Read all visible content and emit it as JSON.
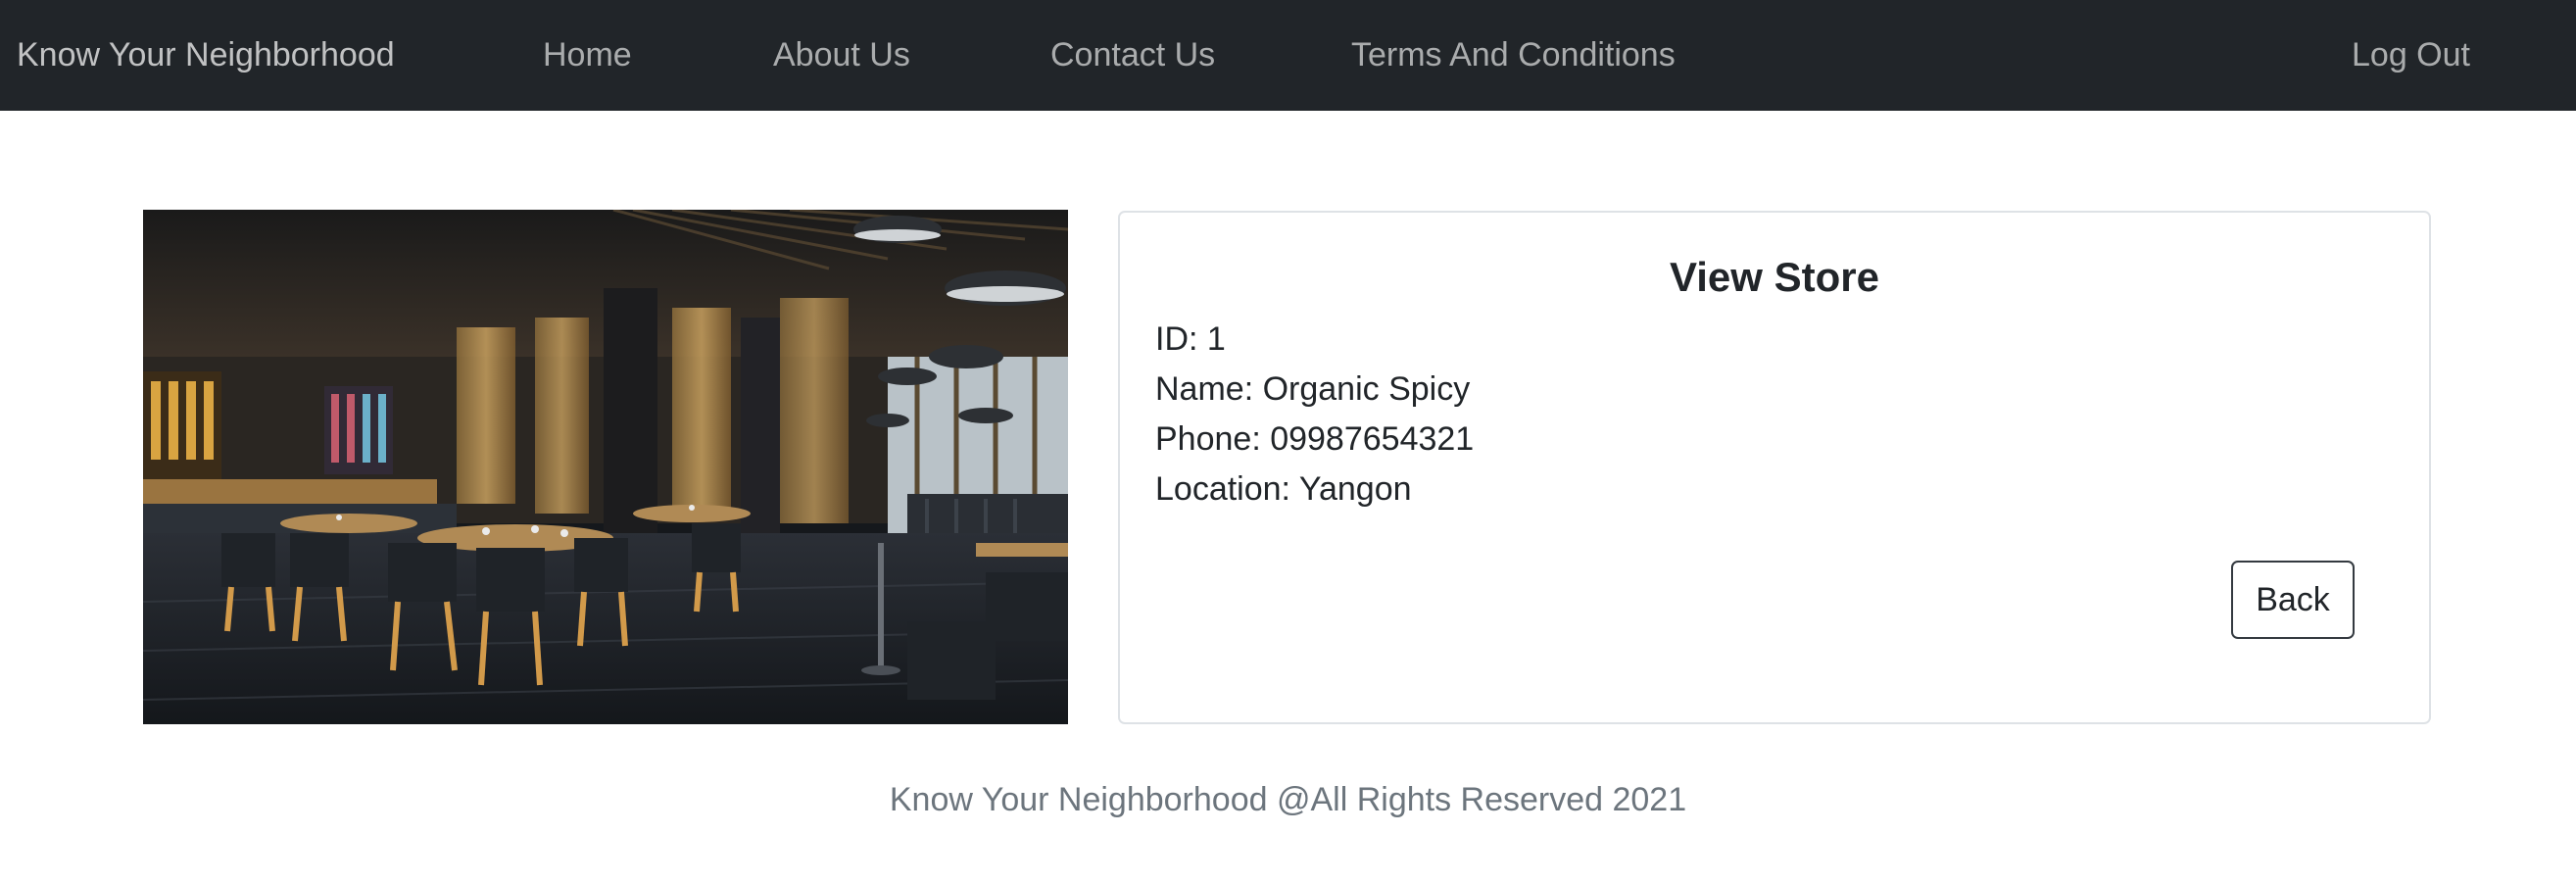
{
  "navbar": {
    "brand": "Know Your Neighborhood",
    "items": [
      {
        "label": "Home"
      },
      {
        "label": "About Us"
      },
      {
        "label": "Contact Us"
      },
      {
        "label": "Terms And Conditions"
      }
    ],
    "logout": "Log Out",
    "background": "#212529"
  },
  "store": {
    "title": "View Store",
    "id": "ID: 1",
    "name": "Name: Organic Spicy",
    "phone": "Phone: 09987654321",
    "location": "Location: Yangon",
    "image_alt": "restaurant interior photo",
    "back_label": "Back"
  },
  "footer": {
    "text": "Know Your Neighborhood @All Rights Reserved 2021"
  }
}
